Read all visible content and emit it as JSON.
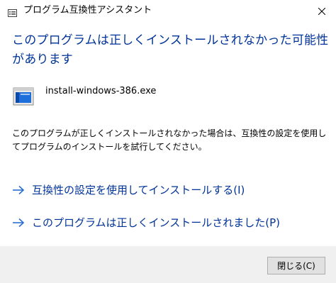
{
  "window": {
    "title": "プログラム互換性アシスタント"
  },
  "heading": "このプログラムは正しくインストールされなかった可能性があります",
  "file": {
    "name": "install-windows-386.exe",
    "icon": "application-window-icon"
  },
  "description": "このプログラムが正しくインストールされなかった場合は、互換性の設定を使用してプログラムのインストールを試行してください。",
  "options": [
    {
      "label": "互換性の設定を使用してインストールする(I)",
      "icon": "arrow-right-icon"
    },
    {
      "label": "このプログラムは正しくインストールされました(P)",
      "icon": "arrow-right-icon"
    }
  ],
  "footer": {
    "close_label": "閉じる(C)"
  },
  "colors": {
    "heading": "#003399",
    "link": "#003399",
    "footer_bg": "#f0f0f0",
    "button_bg": "#e1e1e1"
  }
}
